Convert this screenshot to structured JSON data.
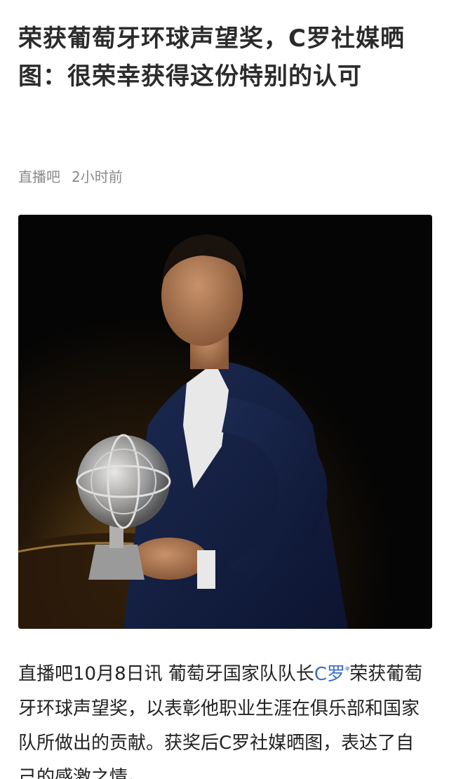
{
  "article": {
    "title": "荣获葡萄牙环球声望奖，C罗社媒晒图：很荣幸获得这份特别的认可",
    "source": "直播吧",
    "time": "2小时前",
    "body_lead": "直播吧10月8日讯  葡萄牙国家队队长",
    "body_link": "C罗",
    "body_rest": "荣获葡萄牙环球声望奖，以表彰他职业生涯在俱乐部和国家队所做出的贡献。获奖后C罗社媒晒图，表达了自己的感激之情。"
  },
  "colors": {
    "link": "#3a6fc4",
    "meta": "#8a8a8a",
    "title": "#2b2b2b"
  },
  "icons": {
    "search_mark": "search-icon"
  }
}
